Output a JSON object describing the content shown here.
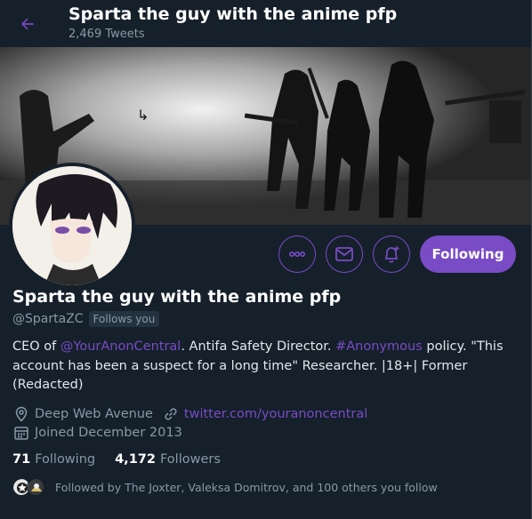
{
  "header": {
    "title": "Sparta the guy with the anime pfp",
    "tweet_count": "2,469 Tweets"
  },
  "actions": {
    "more_icon": "more-icon",
    "message_icon": "mail-icon",
    "notify_icon": "bell-plus-icon",
    "follow_label": "Following"
  },
  "profile": {
    "display_name": "Sparta the guy with the anime pfp",
    "handle": "@SpartaZC",
    "follows_you": "Follows you",
    "bio": {
      "p1": "CEO of ",
      "link1": "@YourAnonCentral",
      "p2": ". Antifa Safety Director. ",
      "link2": "#Anonymous",
      "p3": " policy. \"This account has been a suspect for a long time\" Researcher. |18+| Former (Redacted)"
    },
    "location": "Deep Web Avenue",
    "website": "twitter.com/youranoncentral",
    "joined": "Joined December 2013"
  },
  "stats": {
    "following_count": "71",
    "following_label": "Following",
    "followers_count": "4,172",
    "followers_label": "Followers"
  },
  "followed_by": "Followed by The Joxter, Valeksa Domitrov, and 100 others you follow",
  "colors": {
    "accent": "#794bc4",
    "background": "#15202b",
    "secondary_text": "#8899a6"
  }
}
